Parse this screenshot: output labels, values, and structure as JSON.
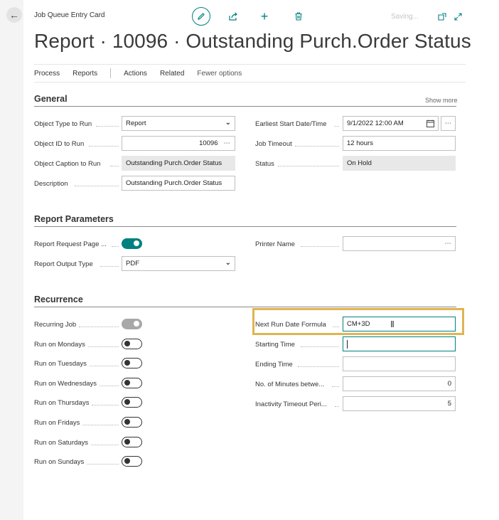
{
  "header": {
    "breadcrumb": "Job Queue Entry Card",
    "saving": "Saving...",
    "title": "Report · 10096 · Outstanding Purch.Order Status"
  },
  "actions": [
    "Process",
    "Reports",
    "Actions",
    "Related",
    "Fewer options"
  ],
  "general": {
    "title": "General",
    "show_more": "Show more",
    "object_type_label": "Object Type to Run",
    "object_type_value": "Report",
    "object_id_label": "Object ID to Run",
    "object_id_value": "10096",
    "object_caption_label": "Object Caption to Run",
    "object_caption_value": "Outstanding Purch.Order Status",
    "description_label": "Description",
    "description_value": "Outstanding Purch.Order Status",
    "earliest_start_label": "Earliest Start Date/Time",
    "earliest_start_value": "9/1/2022 12:00 AM",
    "job_timeout_label": "Job Timeout",
    "job_timeout_value": "12 hours",
    "status_label": "Status",
    "status_value": "On Hold"
  },
  "report_params": {
    "title": "Report Parameters",
    "request_page_label": "Report Request Page ...",
    "request_page_on": true,
    "output_type_label": "Report Output Type",
    "output_type_value": "PDF",
    "printer_label": "Printer Name",
    "printer_value": ""
  },
  "recurrence": {
    "title": "Recurrence",
    "days": [
      {
        "label": "Recurring Job",
        "state": "disabled"
      },
      {
        "label": "Run on Mondays",
        "state": "off"
      },
      {
        "label": "Run on Tuesdays",
        "state": "off"
      },
      {
        "label": "Run on Wednesdays",
        "state": "off"
      },
      {
        "label": "Run on Thursdays",
        "state": "off"
      },
      {
        "label": "Run on Fridays",
        "state": "off"
      },
      {
        "label": "Run on Saturdays",
        "state": "off"
      },
      {
        "label": "Run on Sundays",
        "state": "off"
      }
    ],
    "next_run_label": "Next Run Date Formula",
    "next_run_value": "CM+3D",
    "starting_time_label": "Starting Time",
    "starting_time_value": "",
    "ending_time_label": "Ending Time",
    "ending_time_value": "",
    "minutes_between_label": "No. of Minutes betwe...",
    "minutes_between_value": "0",
    "inactivity_label": "Inactivity Timeout Peri...",
    "inactivity_value": "5"
  },
  "colors": {
    "accent": "#00817f",
    "highlight": "#e0b451"
  }
}
